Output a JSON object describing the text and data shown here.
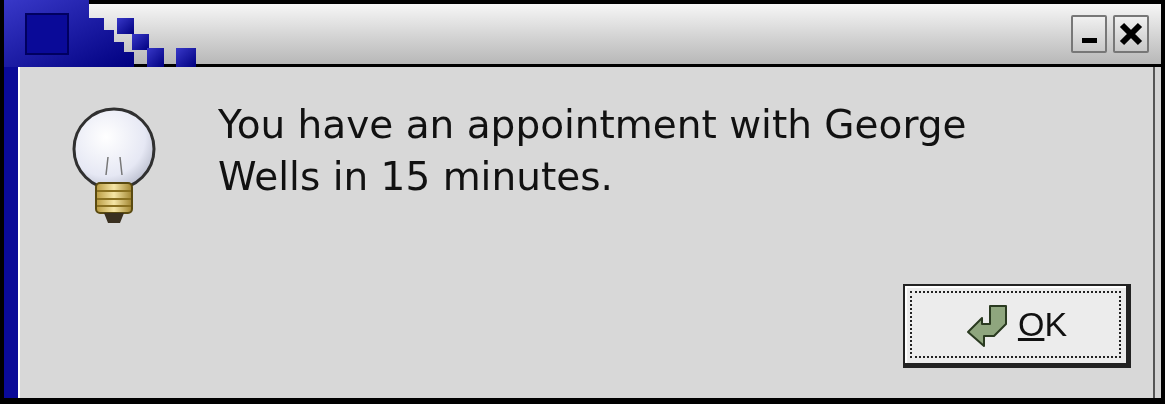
{
  "window": {
    "buttons": [
      {
        "kind": "minimize"
      },
      {
        "kind": "close"
      }
    ]
  },
  "message": "You have an appointment with George Wells in 15 minutes.",
  "buttons": [
    {
      "label": "OK",
      "mnemonic_underlined": true,
      "focused": true
    }
  ]
}
